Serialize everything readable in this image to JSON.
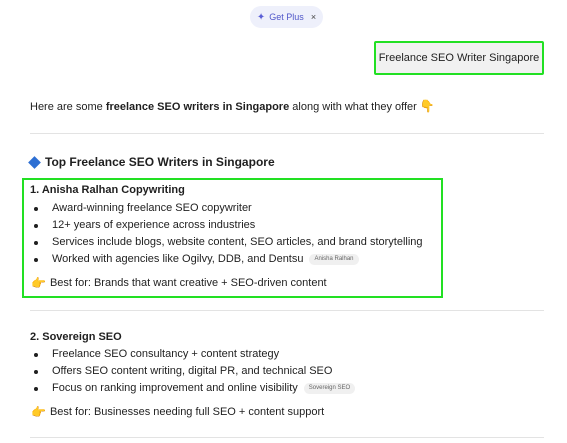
{
  "header": {
    "plus_label": "Get Plus",
    "spark_icon": "✦",
    "close_icon": "×"
  },
  "user_message": "Freelance SEO Writer Singapore",
  "intro": {
    "pre": "Here are some ",
    "bold": "freelance SEO writers in Singapore",
    "post": " along with what they offer ",
    "emoji": "👇"
  },
  "section": {
    "title": "Top Freelance SEO Writers in Singapore"
  },
  "writers": [
    {
      "title": "1. Anisha Ralhan Copywriting",
      "items": [
        "Award-winning freelance SEO copywriter",
        "12+ years of experience across industries",
        "Services include blogs, website content, SEO articles, and brand storytelling",
        "Worked with agencies like Ogilvy, DDB, and Dentsu"
      ],
      "source_chip": "Anisha Ralhan",
      "best_for": "Best for: Brands that want creative + SEO-driven content"
    },
    {
      "title": "2. Sovereign SEO",
      "items": [
        "Freelance SEO consultancy + content strategy",
        "Offers SEO content writing, digital PR, and technical SEO",
        "Focus on ranking improvement and online visibility"
      ],
      "source_chip": "Sovereign SEO",
      "best_for": "Best for: Businesses needing full SEO + content support"
    }
  ],
  "hand_icon": "👉",
  "colors": {
    "highlight": "#22e023",
    "accent": "#2d6fd3",
    "plus_text": "#4f56c9"
  }
}
